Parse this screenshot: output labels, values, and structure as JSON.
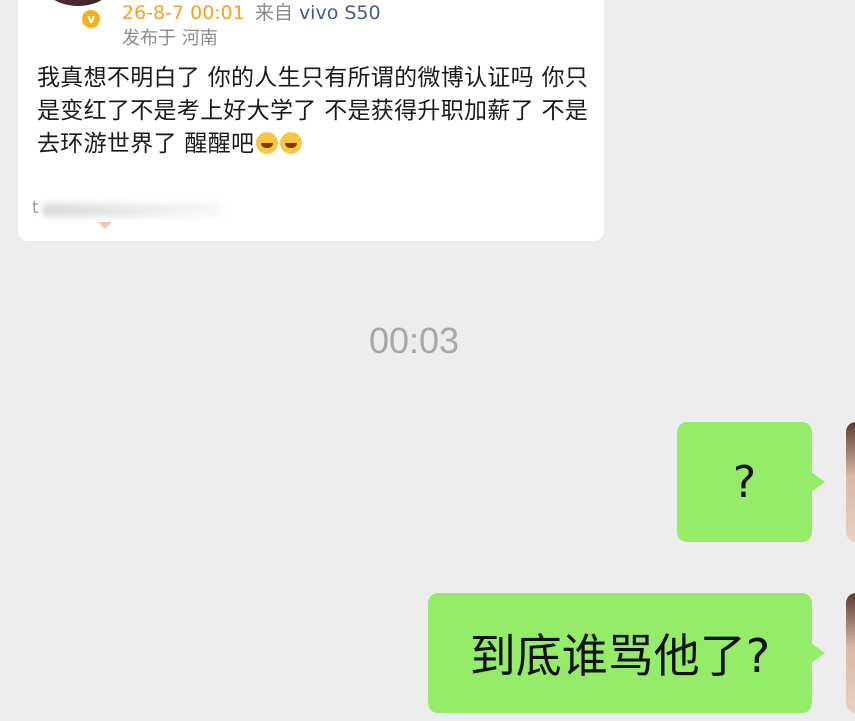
{
  "post_card": {
    "date": "26-8-7 00:01",
    "source_prefix": "来自",
    "device": "vivo S50",
    "location": "发布于 河南",
    "verified_mark": "v",
    "text": "我真想不明白了 你的人生只有所谓的微博认证吗 你只是变红了不是考上好大学了 不是获得升职加薪了 不是去环游世界了 醒醒吧",
    "emoji_icons": [
      "laugh-cry-emoji",
      "laugh-cry-emoji"
    ],
    "footer_text": "t"
  },
  "timestamp": "00:03",
  "messages": [
    {
      "text": "?",
      "side": "right"
    },
    {
      "text": "到底谁骂他了?",
      "side": "right"
    }
  ],
  "colors": {
    "background": "#ededed",
    "card": "#ffffff",
    "bubble_green": "#95ec69",
    "date_orange": "#f0a126",
    "timestamp_grey": "#a7a7a7"
  }
}
